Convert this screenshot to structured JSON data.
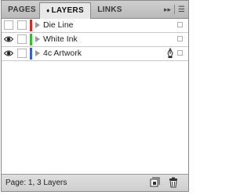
{
  "tabs": [
    {
      "label": "PAGES"
    },
    {
      "caret": "♦",
      "label": "LAYERS"
    },
    {
      "label": "LINKS"
    }
  ],
  "panel_menu": {
    "collapse_glyph": "▸▸",
    "menu_glyph": "☰"
  },
  "layers": [
    {
      "name": "Die Line",
      "color": "#d62a2a",
      "visible": false,
      "locked": false,
      "has_pen": false
    },
    {
      "name": "White Ink",
      "color": "#3cb83c",
      "visible": true,
      "locked": false,
      "has_pen": false
    },
    {
      "name": "4c Artwork",
      "color": "#3a5fd0",
      "visible": true,
      "locked": false,
      "has_pen": true
    }
  ],
  "footer": {
    "status": "Page: 1, 3 Layers"
  },
  "icons": [
    "eye-icon",
    "pen-icon",
    "disclosure-triangle-icon",
    "new-layer-icon",
    "trash-icon",
    "panel-menu-icon"
  ]
}
